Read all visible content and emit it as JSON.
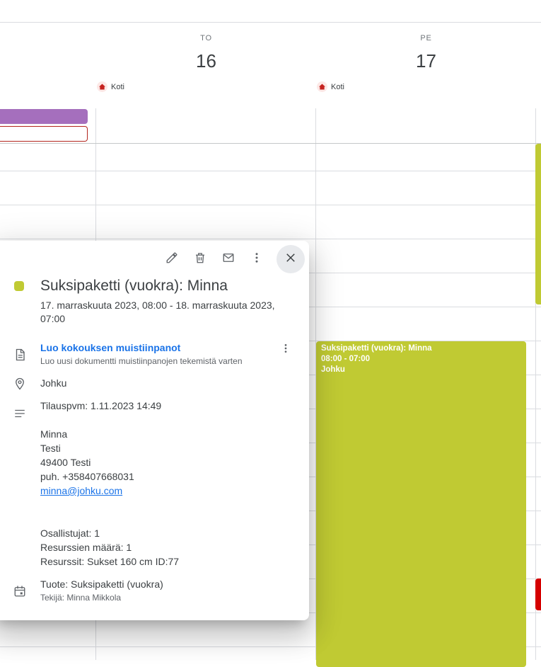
{
  "days": [
    {
      "dow": "TO",
      "num": "16",
      "location": "Koti"
    },
    {
      "dow": "PE",
      "num": "17",
      "location": "Koti"
    }
  ],
  "colors": {
    "event_lime": "#c0ca33",
    "event_purple": "#a56fbd",
    "event_red": "#d50000",
    "link": "#1a73e8",
    "home": "#c5221f"
  },
  "events": {
    "main": {
      "title": "Suksipaketti (vuokra): Minna",
      "time": "08:00 - 07:00",
      "location": "Johku"
    }
  },
  "popup": {
    "toolbar": {
      "edit_icon": "pencil-icon",
      "delete_icon": "trash-icon",
      "email_icon": "mail-icon",
      "more_icon": "more-vert-icon",
      "close_icon": "close-icon"
    },
    "title": "Suksipaketti (vuokra): Minna",
    "datetime": "17. marraskuuta 2023, 08:00 - 18. marraskuuta 2023, 07:00",
    "notes_link": "Luo kokouksen muistiinpanot",
    "notes_sub": "Luo uusi dokumentti muistiinpanojen tekemistä varten",
    "location": "Johku",
    "description": {
      "order_date": "Tilauspvm: 1.11.2023 14:49",
      "name": "Minna",
      "street": "Testi",
      "postal": "49400 Testi",
      "phone": "puh. +358407668031",
      "email": "minna@johku.com",
      "participants": "Osallistujat: 1",
      "resource_count": "Resurssien määrä: 1",
      "resources": "Resurssit: Sukset 160 cm ID:77"
    },
    "calendar_label": "Tuote: Suksipaketti (vuokra)",
    "creator": "Tekijä: Minna Mikkola"
  }
}
